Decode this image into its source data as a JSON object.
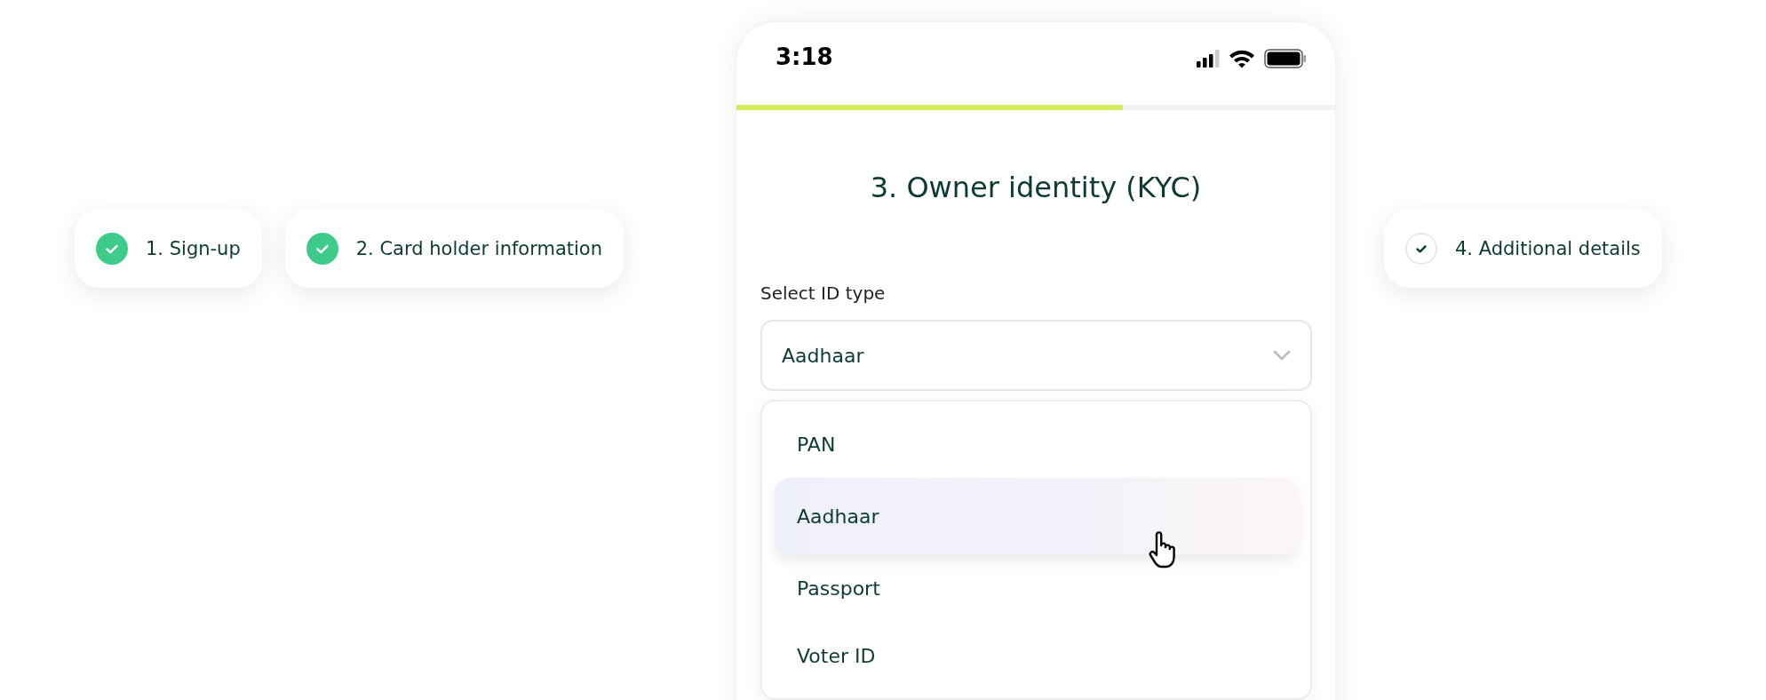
{
  "left_steps": [
    {
      "label": "1. Sign-up",
      "done": true
    },
    {
      "label": "2. Card holder information",
      "done": true
    }
  ],
  "phone": {
    "status_bar": {
      "time": "3:18"
    },
    "progress": {
      "level": 0.645
    },
    "title": "3. Owner identity (KYC)",
    "id_type": {
      "label": "Select ID type",
      "value": "Aadhaar",
      "expanded": true,
      "options": [
        {
          "label": "PAN",
          "selected": false
        },
        {
          "label": "Aadhaar",
          "selected": true
        },
        {
          "label": "Passport",
          "selected": false
        },
        {
          "label": "Voter ID",
          "selected": false
        }
      ]
    }
  },
  "right_steps": [
    {
      "label": "4. Additional details",
      "done": false
    }
  ]
}
